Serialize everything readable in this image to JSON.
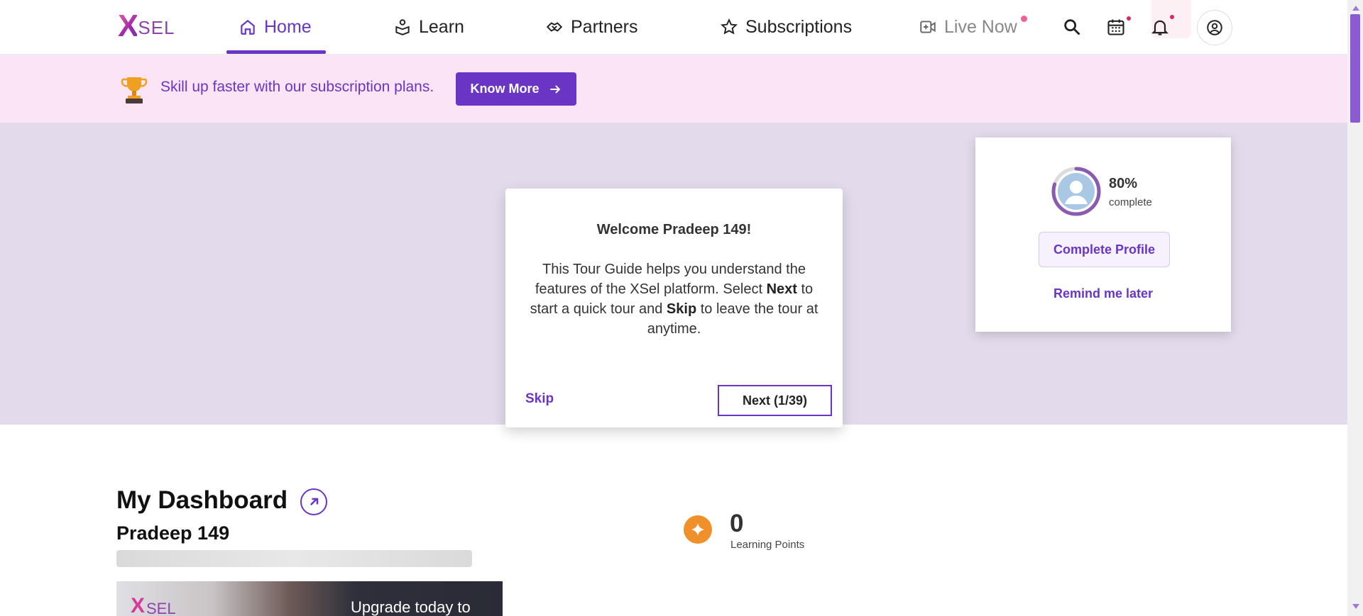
{
  "header": {
    "logo": {
      "mark": "X",
      "text": "SEL"
    },
    "nav": [
      {
        "label": "Home",
        "icon": "home-icon",
        "active": true
      },
      {
        "label": "Learn",
        "icon": "learn-icon"
      },
      {
        "label": "Partners",
        "icon": "partners-icon"
      },
      {
        "label": "Subscriptions",
        "icon": "star-icon"
      },
      {
        "label": "Live Now",
        "icon": "video-icon"
      }
    ],
    "icons": [
      "search-icon",
      "calendar-icon",
      "bell-icon",
      "user-circle-icon"
    ]
  },
  "banner": {
    "text": "Skill up faster with our subscription plans.",
    "button": "Know More"
  },
  "profile_card": {
    "percent": "80%",
    "percent_value": 0.8,
    "percent_label": "complete",
    "button": "Complete Profile",
    "remind": "Remind me later"
  },
  "tour": {
    "title": "Welcome Pradeep 149!",
    "body_1": "This Tour Guide helps you understand the features of the XSel platform. Select ",
    "body_next": "Next",
    "body_2": " to start a quick tour and ",
    "body_skip": "Skip",
    "body_3": " to leave the tour at anytime.",
    "skip": "Skip",
    "next": "Next (1/39)"
  },
  "dashboard": {
    "title": "My Dashboard",
    "user_name": "Pradeep 149",
    "points_value": "0",
    "points_label": "Learning Points",
    "promo_logo_mark": "X",
    "promo_logo_text": "SEL",
    "promo_text": "Upgrade today to"
  },
  "colors": {
    "accent": "#6a35c4",
    "banner_bg": "#fce4f7",
    "overlay_bg": "#e3dbec",
    "points": "#f0902a"
  }
}
